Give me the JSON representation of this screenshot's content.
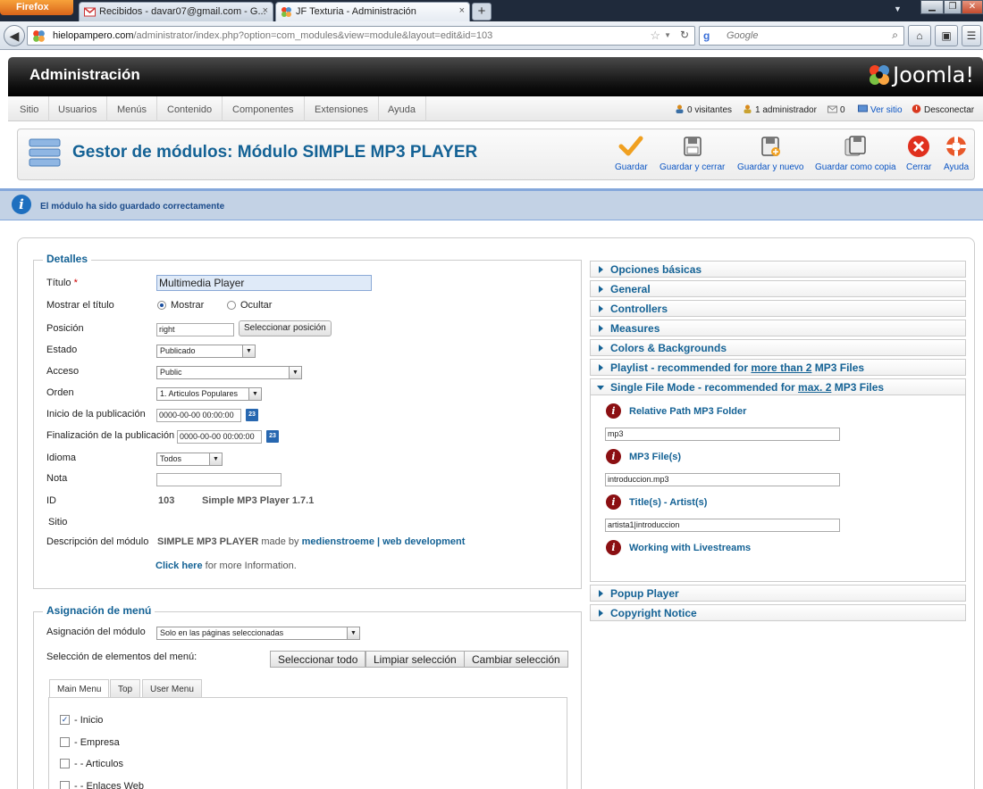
{
  "browser": {
    "menu_button": "Firefox",
    "tabs": [
      {
        "title": "Recibidos - davar07@gmail.com - G...",
        "close": "×"
      },
      {
        "title": "JF Texturia - Administración",
        "close": "×"
      }
    ],
    "new_tab": "+",
    "url_host": "hielopampero.com",
    "url_path": "/administrator/index.php?option=com_modules&view=module&layout=edit&id=103",
    "search_placeholder": "Google"
  },
  "admin": {
    "title": "Administración",
    "logo": "Joomla!",
    "menu": [
      "Sitio",
      "Usuarios",
      "Menús",
      "Contenido",
      "Componentes",
      "Extensiones",
      "Ayuda"
    ],
    "status": {
      "visitors": "0 visitantes",
      "admins": "1 administrador",
      "messages": "0",
      "view_site": "Ver sitio",
      "logout": "Desconectar"
    }
  },
  "toolbar": {
    "title": "Gestor de módulos: Módulo SIMPLE MP3 PLAYER",
    "buttons": [
      "Guardar",
      "Guardar y cerrar",
      "Guardar y nuevo",
      "Guardar como copia",
      "Cerrar",
      "Ayuda"
    ]
  },
  "message": "El módulo ha sido guardado correctamente",
  "details": {
    "legend": "Detalles",
    "title_label": "Título",
    "required_mark": "*",
    "title_value": "Multimedia Player",
    "show_title_label": "Mostrar el título",
    "show_option": "Mostrar",
    "hide_option": "Ocultar",
    "position_label": "Posición",
    "position_value": "right",
    "select_position_button": "Seleccionar posición",
    "state_label": "Estado",
    "state_value": "Publicado",
    "access_label": "Acceso",
    "access_value": "Public",
    "order_label": "Orden",
    "order_value": "1. Articulos Populares",
    "publish_up_label": "Inicio de la publicación",
    "publish_up_value": "0000-00-00 00:00:00",
    "publish_down_label": "Finalización de la publicación",
    "publish_down_value": "0000-00-00 00:00:00",
    "calendar_icon": "23",
    "language_label": "Idioma",
    "language_value": "Todos",
    "note_label": "Nota",
    "note_value": "",
    "id_label": "ID",
    "id_value": "103",
    "module_name": "Simple MP3 Player 1.7.1",
    "site_label": "Sitio",
    "description_label": "Descripción del módulo",
    "desc_part1": "SIMPLE MP3 PLAYER",
    "desc_made_by": "made by",
    "desc_link": "medienstroeme | web development",
    "click_here": "Click here",
    "more_info": "for more Information."
  },
  "menu_assignment": {
    "legend": "Asignación de menú",
    "module_assignment_label": "Asignación del módulo",
    "module_assignment_value": "Solo en las páginas seleccionadas",
    "selection_label": "Selección de elementos del menú:",
    "buttons": [
      "Seleccionar todo",
      "Limpiar selección",
      "Cambiar selección"
    ],
    "tabs": [
      "Main Menu",
      "Top",
      "User Menu"
    ],
    "items": [
      {
        "label": "- Inicio",
        "checked": "✓"
      },
      {
        "label": "- Empresa",
        "checked": ""
      },
      {
        "label": "- - Articulos",
        "checked": ""
      },
      {
        "label": "- - Enlaces Web",
        "checked": ""
      }
    ]
  },
  "panels": {
    "items": [
      "Opciones básicas",
      "General",
      "Controllers",
      "Measures",
      "Colors & Backgrounds"
    ],
    "playlist": {
      "prefix": "Playlist - recommended for ",
      "link": "more than 2",
      "suffix": " MP3 Files"
    },
    "single": {
      "prefix": "Single File Mode - recommended for ",
      "link": "max. 2",
      "suffix": " MP3 Files"
    },
    "fields": [
      {
        "label": "Relative Path MP3 Folder",
        "value": "mp3"
      },
      {
        "label": "MP3 File(s)",
        "value": "introduccion.mp3"
      },
      {
        "label": "Title(s) - Artist(s)",
        "value": "artista1|introduccion"
      }
    ],
    "livestreams": "Working with Livestreams",
    "info_icon": "i",
    "bottom": [
      "Popup Player",
      "Copyright Notice"
    ]
  }
}
